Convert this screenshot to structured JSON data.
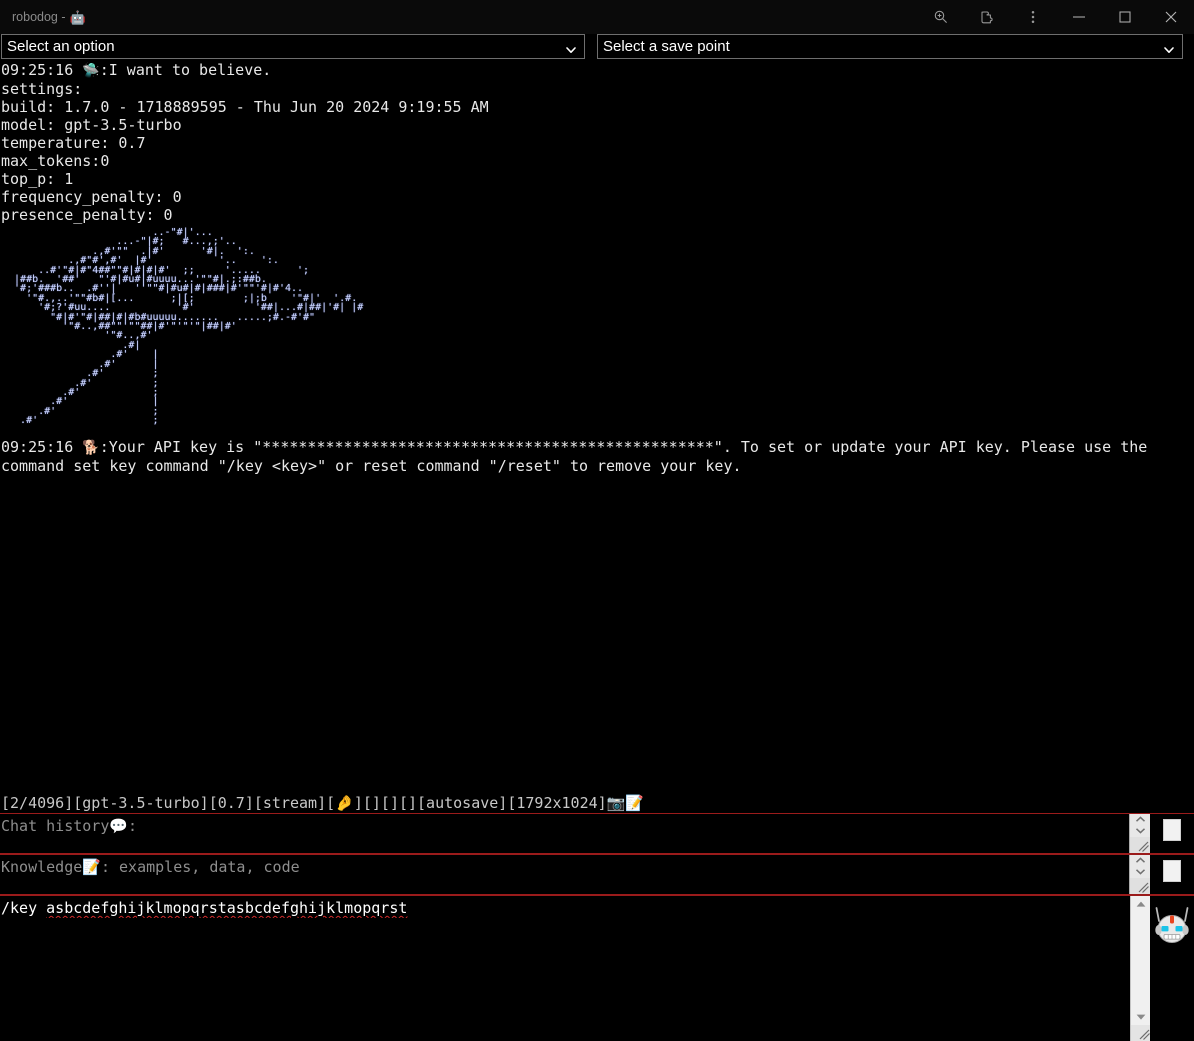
{
  "window": {
    "title": "robodog -",
    "title_emoji": "🤖",
    "controls": [
      {
        "name": "search-icon",
        "label": "Search"
      },
      {
        "name": "extensions-icon",
        "label": "Extensions"
      },
      {
        "name": "menu-icon",
        "label": "More options"
      },
      {
        "name": "minimize-icon",
        "label": "Minimize"
      },
      {
        "name": "maximize-icon",
        "label": "Maximize"
      },
      {
        "name": "close-icon",
        "label": "Close"
      }
    ]
  },
  "selects": {
    "option_select": "Select an option",
    "savepoint_select": "Select a save point"
  },
  "terminal": {
    "header_lines": [
      {
        "time": "09:25:16",
        "emoji": "🛸",
        "text": ":I want to believe."
      },
      {
        "text": "settings:"
      },
      {
        "text": "build: 1.7.0 - 1718889595 - Thu Jun 20 2024 9:19:55 AM"
      },
      {
        "text": "model: gpt-3.5-turbo"
      },
      {
        "text": "temperature: 0.7"
      },
      {
        "text": "max_tokens:0"
      },
      {
        "text": "top_p: 1"
      },
      {
        "text": "frequency_penalty: 0"
      },
      {
        "text": "presence_penalty: 0"
      }
    ],
    "ascii_art": "                         ..-\"#|'...\n                   ...-\"|#;   #...,;'..\n               .,#'\"\"  .|#'      '#|.  ':.\n           .,#\"#',#'  |#'           '..    ':.\n      ..#'\"#|#\"4##\"\"#|#|#|#'  ;;     '.....      ';\n  |##b.  '##'   \"'#|#u#|#uuuu...'\"\"#|.;:##b.\n  '#;'###b..  .#''|   ''\"\"#|#u#|#|###|#'\"\"'#|#'4..\n    '\"#.,..'\"\"#b#|[...      ;|[;        ;|;b    '\"#|'  '.#.\n      '#;?'#uu....           '#'          '##|...#|##|'#| |#\n        \"#|#'\"#|##|#|#b#uuuuu.......   .....;#.-#'#\"\n          '\"#..,##\"\"'\"\"##|#'\"'\"'\"|##|#'\n                 '\"#..,#'\n                    .#|\n                  .#'    |\n                .#'      |\n              .#'        ;\n            .#'          ;\n          .#'            ;\n        .#'              |\n      .#'                ;\n   .#'                   ;",
    "api_key_message": {
      "time": "09:25:16",
      "emoji": "🐕",
      "text": ":Your API key is \"**************************************************\". To set or update your API key. Please use the command set key command \"/key <key>\" or reset command \"/reset\" to remove your key."
    }
  },
  "statusbar": {
    "text": "[2/4096][gpt-3.5-turbo][0.7][stream][🤌][][][][autosave][1792x1024]📷📝",
    "tokens": "2/4096",
    "model": "gpt-3.5-turbo",
    "temperature": "0.7",
    "mode": "stream",
    "autosave": "autosave",
    "resolution": "1792x1024"
  },
  "inputs": {
    "chat_history": {
      "placeholder": "Chat history💬:",
      "value": ""
    },
    "knowledge": {
      "placeholder": "Knowledge📝: examples, data, code",
      "value": ""
    },
    "prompt": {
      "command": "/key",
      "argument": "asbcdefghijklmopqrstasbcdefghijklmopqrst",
      "value": "/key asbcdefghijklmopqrstasbcdefghijklmopqrst"
    }
  },
  "colors": {
    "background": "#000000",
    "text": "#e8e8e8",
    "placeholder": "#8e8e8e",
    "border_accent": "#9b1b1b",
    "ascii_art": "#cfd8ff"
  }
}
